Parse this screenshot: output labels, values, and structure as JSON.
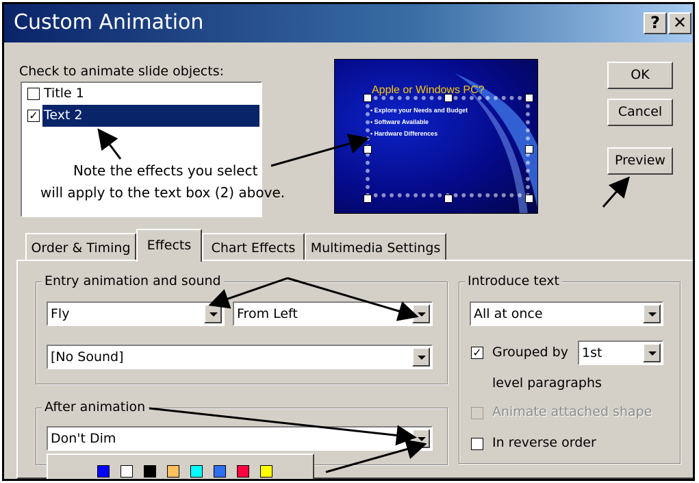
{
  "window": {
    "title": "Custom Animation",
    "help_glyph": "?",
    "close_glyph": "✕"
  },
  "objects": {
    "label": "Check to animate slide objects:",
    "items": [
      {
        "label": "Title 1",
        "checked": false
      },
      {
        "label": "Text 2",
        "checked": true
      }
    ]
  },
  "note": {
    "line1": "Note the effects you select",
    "line2": "will apply to the text box (2) above."
  },
  "buttons": {
    "ok": "OK",
    "cancel": "Cancel",
    "preview": "Preview"
  },
  "slide_preview": {
    "title": "Apple or Windows PC?",
    "bullets": [
      "Explore your Needs and Budget",
      "Software Available",
      "Hardware Differences"
    ]
  },
  "tabs": [
    {
      "label": "Order & Timing",
      "active": false
    },
    {
      "label": "Effects",
      "active": true
    },
    {
      "label": "Chart Effects",
      "active": false
    },
    {
      "label": "Multimedia Settings",
      "active": false
    }
  ],
  "entry": {
    "group_label": "Entry animation and sound",
    "effect": "Fly",
    "direction": "From Left",
    "sound": "[No Sound]"
  },
  "after": {
    "group_label": "After animation",
    "value": "Don't Dim"
  },
  "introduce": {
    "group_label": "Introduce text",
    "value": "All at once",
    "grouped_label": "Grouped by",
    "grouped_checked": true,
    "level_value": "1st",
    "level_text": "level paragraphs",
    "attached_label": "Animate attached shape",
    "attached_enabled": false,
    "reverse_label": "In reverse order",
    "reverse_checked": false
  },
  "color_swatches": [
    "#0000ff",
    "#ffffff",
    "#000000",
    "#ffc060",
    "#00ffff",
    "#3070f0",
    "#ff0040",
    "#ffff00"
  ],
  "check_glyph": "✓"
}
